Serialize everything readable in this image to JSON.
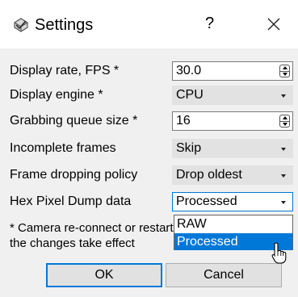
{
  "window": {
    "title": "Settings",
    "help_label": "?"
  },
  "fields": [
    {
      "label": "Display rate, FPS *",
      "value": "30.0"
    },
    {
      "label": "Display engine *",
      "value": "CPU"
    },
    {
      "label": "Grabbing queue size *",
      "value": "16"
    },
    {
      "label": "Incomplete frames",
      "value": "Skip"
    },
    {
      "label": "Frame dropping policy",
      "value": "Drop oldest"
    },
    {
      "label": "Hex Pixel Dump data",
      "value": "Processed"
    }
  ],
  "dropdown_options": [
    "RAW",
    "Processed"
  ],
  "note": "* Camera re-connect or restart is required to make the changes take effect",
  "buttons": {
    "ok": "OK",
    "cancel": "Cancel"
  },
  "colors": {
    "accent": "#0078d7",
    "dialog_bg": "#f0f0f0"
  }
}
